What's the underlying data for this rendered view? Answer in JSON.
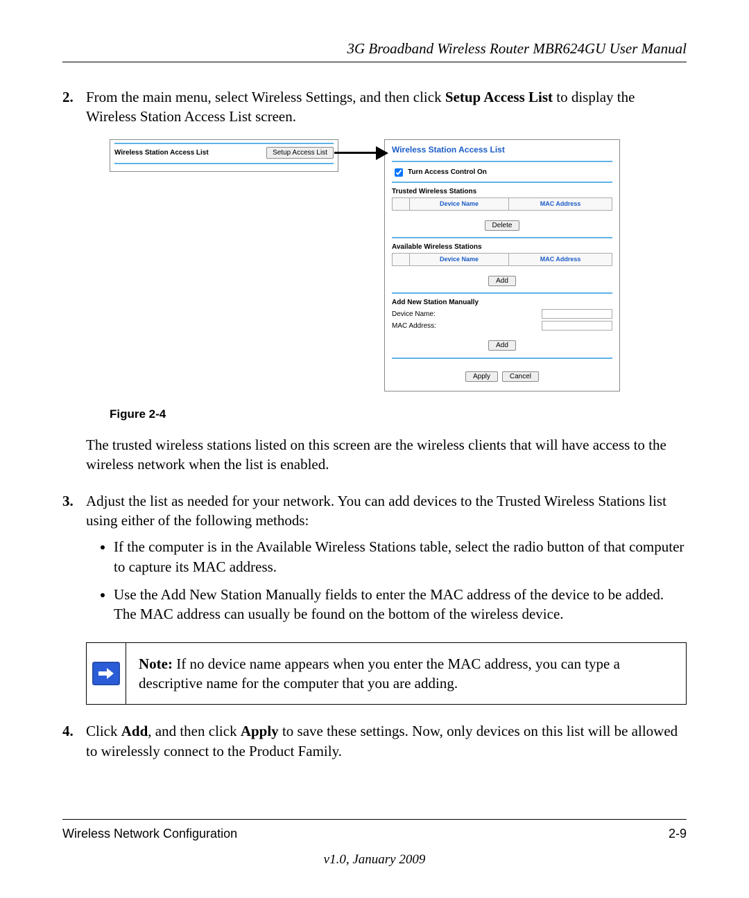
{
  "header": {
    "title": "3G Broadband Wireless Router MBR624GU User Manual"
  },
  "steps": {
    "s2_num": "2.",
    "s2_a": "From the main menu, select Wireless Settings, and then click ",
    "s2_bold": "Setup Access List",
    "s2_b": " to display the Wireless Station Access List screen.",
    "s2_after": "The trusted wireless stations listed on this screen are the wireless clients that will have access to the wireless network when the list is enabled.",
    "s3_num": "3.",
    "s3_text": "Adjust the list as needed for your network. You can add devices to the Trusted Wireless Stations list using either of the following methods:",
    "bullet1": "If the computer is in the Available Wireless Stations table, select the radio button of that computer to capture its MAC address.",
    "bullet2": "Use the Add New Station Manually fields to enter the MAC address of the device to be added. The MAC address can usually be found on the bottom of the wireless device.",
    "s4_num": "4.",
    "s4_a": "Click ",
    "s4_b1": "Add",
    "s4_b": ", and then click ",
    "s4_b2": "Apply",
    "s4_c": " to save these settings. Now, only devices on this list will be allowed to wirelessly connect to the Product Family."
  },
  "figure": {
    "left_label": "Wireless Station Access List",
    "left_button": "Setup Access List",
    "caption": "Figure 2-4",
    "right": {
      "title": "Wireless Station Access List",
      "checkbox_label": "Turn Access Control On",
      "trusted_heading": "Trusted Wireless Stations",
      "col_device": "Device Name",
      "col_mac": "MAC Address",
      "delete_btn": "Delete",
      "available_heading": "Available Wireless Stations",
      "add_btn": "Add",
      "manual_heading": "Add New Station Manually",
      "field_device": "Device Name:",
      "field_mac": "MAC Address:",
      "apply_btn": "Apply",
      "cancel_btn": "Cancel"
    }
  },
  "note": {
    "label": "Note:",
    "text": " If no device name appears when you enter the MAC address, you can type a descriptive name for the computer that you are adding."
  },
  "footer": {
    "left": "Wireless Network Configuration",
    "right": "2-9",
    "version": "v1.0, January 2009"
  }
}
